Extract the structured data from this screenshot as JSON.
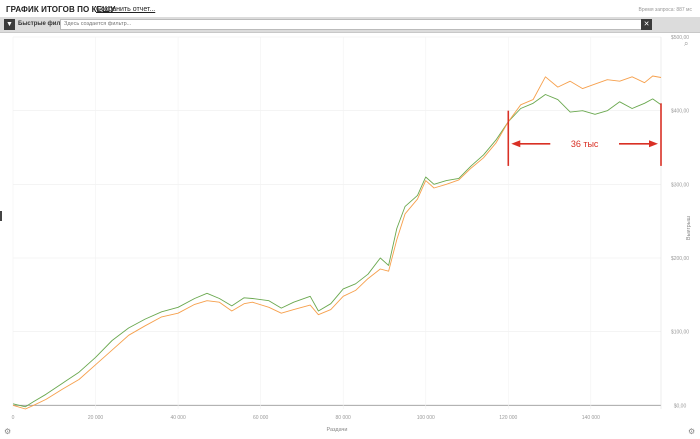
{
  "header": {
    "title": "ГРАФИК ИТОГОВ ПО КЕШУ",
    "save_link": "Сохранить отчет...",
    "query_time": "Время запроса: 887 мс"
  },
  "filters": {
    "label": "Быстрые фильт",
    "placeholder": "Здесь создается фильтр...",
    "clear_label": "✕",
    "icon": "filter-icon"
  },
  "chart_data": {
    "type": "line",
    "xlabel": "Раздачи",
    "ylabel": "Выигрыш",
    "xlim": [
      0,
      157000
    ],
    "ylim": [
      -5,
      500
    ],
    "x_ticks": [
      "0",
      "20 000",
      "40 000",
      "60 000",
      "80 000",
      "100 000",
      "120 000",
      "140 000"
    ],
    "y_ticks": [
      "$0,00",
      "$100,00",
      "$200,00",
      "$300,00",
      "$400,00",
      "$500,00"
    ],
    "grid": true,
    "colors": {
      "green": "#6aa84f",
      "orange": "#f6a04d"
    },
    "series": [
      {
        "color": "#6aa84f",
        "x": [
          0,
          3000,
          5000,
          8000,
          12000,
          16000,
          20000,
          24000,
          28000,
          32000,
          36000,
          40000,
          44000,
          47000,
          50000,
          53000,
          56000,
          58000,
          62000,
          65000,
          68000,
          72000,
          74000,
          77000,
          80000,
          83000,
          86000,
          89000,
          91000,
          93000,
          95000,
          98000,
          100000,
          102000,
          105000,
          108000,
          111000,
          114000,
          117000,
          120000,
          123000,
          126000,
          129000,
          132000,
          135000,
          138000,
          141000,
          144000,
          147000,
          150000,
          153000,
          155000,
          157000
        ],
        "y": [
          2,
          -2,
          5,
          15,
          30,
          45,
          65,
          88,
          105,
          117,
          127,
          133,
          145,
          152,
          145,
          135,
          146,
          145,
          142,
          132,
          140,
          148,
          128,
          138,
          158,
          165,
          178,
          200,
          190,
          240,
          270,
          285,
          310,
          300,
          305,
          308,
          325,
          340,
          360,
          385,
          403,
          410,
          422,
          415,
          398,
          400,
          395,
          400,
          412,
          403,
          410,
          416,
          408
        ]
      },
      {
        "color": "#f6a04d",
        "x": [
          0,
          3000,
          5000,
          8000,
          12000,
          16000,
          20000,
          24000,
          28000,
          32000,
          36000,
          40000,
          44000,
          47000,
          50000,
          53000,
          56000,
          58000,
          62000,
          65000,
          68000,
          72000,
          74000,
          77000,
          80000,
          83000,
          86000,
          89000,
          91000,
          93000,
          95000,
          98000,
          100000,
          102000,
          105000,
          108000,
          111000,
          114000,
          117000,
          120000,
          123000,
          126000,
          129000,
          132000,
          135000,
          138000,
          141000,
          144000,
          147000,
          150000,
          153000,
          155000,
          157000
        ],
        "y": [
          0,
          -5,
          0,
          8,
          22,
          35,
          55,
          75,
          95,
          108,
          120,
          125,
          137,
          142,
          140,
          128,
          138,
          140,
          133,
          125,
          130,
          136,
          123,
          130,
          148,
          156,
          172,
          185,
          182,
          225,
          260,
          280,
          305,
          295,
          300,
          306,
          322,
          336,
          356,
          385,
          408,
          415,
          446,
          432,
          440,
          430,
          436,
          442,
          440,
          446,
          438,
          447,
          445
        ]
      }
    ],
    "annotation": {
      "text": "36 тыс",
      "x_from": 120000,
      "x_to": 157000,
      "y": 355,
      "color": "#d93025"
    }
  },
  "footer": {
    "left_icon": "gear-icon",
    "right_icon": "settings-icon"
  }
}
